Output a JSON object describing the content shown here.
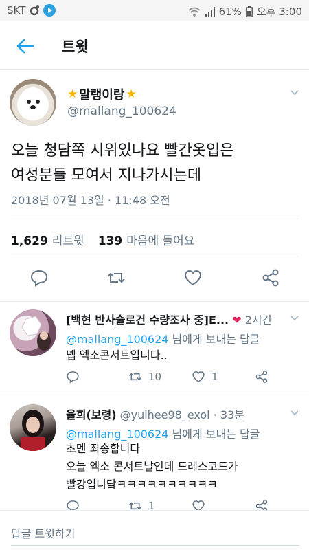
{
  "status_bar": {
    "carrier": "SKT",
    "battery": "61%",
    "time": "오후 3:00"
  },
  "header": {
    "title": "트윗"
  },
  "tweet": {
    "display_name": "말랭이랑",
    "handle": "@mallang_100624",
    "text_line1": "오늘 청담쪽 시위있나요 빨간옷입은",
    "text_line2": "여성분들 모여서 지나가시는데",
    "timestamp": "2018년 07월 13일 · 11:48 오전",
    "retweet_count": "1,629",
    "retweet_label": "리트윗",
    "like_count": "139",
    "like_label": "마음에 들어요"
  },
  "replies": [
    {
      "name": "[백현 반사슬로건 수량조사 중]E...",
      "time": "2시간",
      "reply_to_handle": "@mallang_100624",
      "reply_to_suffix": " 님에게 보내는 답글",
      "line1": "넵 엑소콘서트입니다..",
      "line2": "",
      "line3": "",
      "retweets": "10",
      "likes": "1"
    },
    {
      "name": "율희(보령)",
      "handle": "@yulhee98_exol",
      "time": "· 33분",
      "reply_to_handle": "@mallang_100624",
      "reply_to_suffix": " 님에게 보내는 답글",
      "line1": "초멘 죄송합니다",
      "line2": "오늘 엑소 콘서트날인데 드레스코드가",
      "line3": "빨강입니닼ㅋㅋㅋㅋㅋㅋㅋㅋㅋㅋ",
      "retweets": "1",
      "likes": ""
    }
  ],
  "compose": {
    "placeholder": "답글 트윗하기"
  },
  "colors": {
    "accent": "#1da1f2",
    "muted": "#657786",
    "text": "#14171a",
    "heart": "#e0245e"
  }
}
